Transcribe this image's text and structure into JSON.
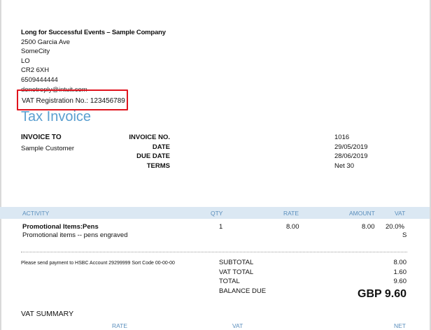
{
  "company": {
    "name": "Long for Successful Events – Sample Company",
    "address_lines": [
      "2500 Garcia Ave",
      "SomeCity",
      "LO",
      "CR2 6XH",
      "6509444444"
    ],
    "email": "donotreply@intuit.com",
    "vat_registration": "VAT Registration No.: 123456789"
  },
  "document": {
    "title": "Tax Invoice",
    "invoice_to_label": "INVOICE TO",
    "customer": "Sample Customer",
    "meta": [
      {
        "label": "INVOICE NO.",
        "value": "1016"
      },
      {
        "label": "DATE",
        "value": "29/05/2019"
      },
      {
        "label": "DUE DATE",
        "value": "28/06/2019"
      },
      {
        "label": "TERMS",
        "value": "Net 30"
      }
    ]
  },
  "table": {
    "headers": {
      "activity": "ACTIVITY",
      "qty": "QTY",
      "rate": "RATE",
      "amount": "AMOUNT",
      "vat": "VAT"
    },
    "rows": [
      {
        "name": "Promotional Items:Pens",
        "description": "Promotional items -- pens engraved",
        "qty": "1",
        "rate": "8.00",
        "amount": "8.00",
        "vat": "20.0%",
        "vat_code": "S"
      }
    ]
  },
  "payment_note": "Please send payment to HSBC Account 29299999 Sort Code 00-00-00",
  "totals": [
    {
      "label": "SUBTOTAL",
      "value": "8.00"
    },
    {
      "label": "VAT TOTAL",
      "value": "1.60"
    },
    {
      "label": "TOTAL",
      "value": "9.60"
    },
    {
      "label": "BALANCE DUE",
      "value": ""
    }
  ],
  "balance_due": "GBP 9.60",
  "vat_summary": {
    "title": "VAT SUMMARY",
    "headers": {
      "rate": "RATE",
      "vat": "VAT",
      "net": "NET"
    }
  },
  "colors": {
    "accent": "#5a9fd0",
    "highlight": "#e0141e",
    "header_bg": "#dbe8f3"
  }
}
